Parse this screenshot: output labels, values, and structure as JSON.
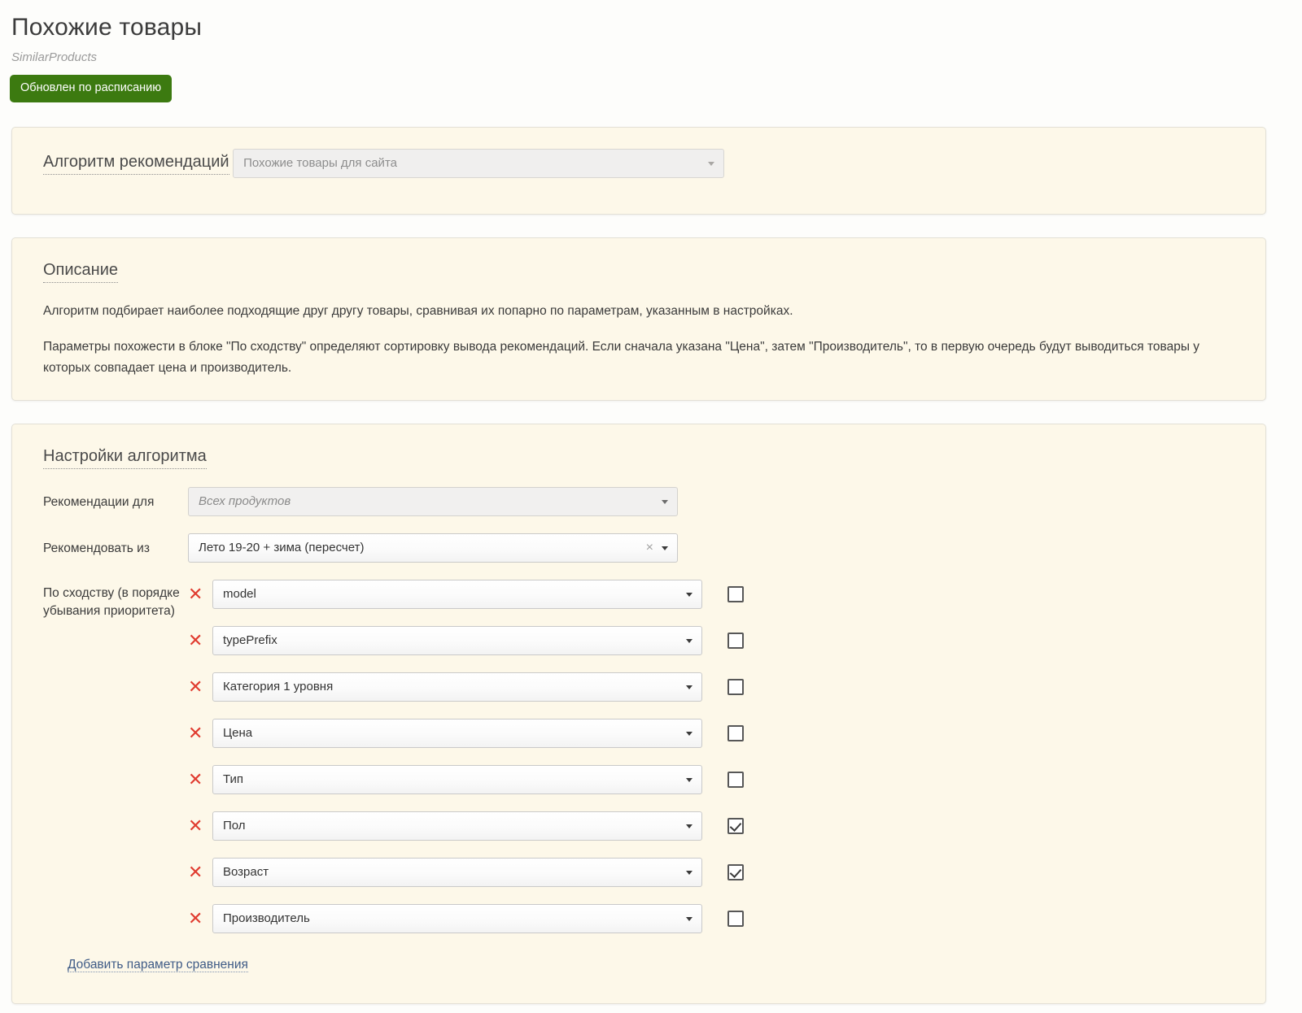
{
  "header": {
    "title": "Похожие товары",
    "subtitle": "SimilarProducts",
    "status_badge": "Обновлен по расписанию",
    "badge_color": "#3c7a10"
  },
  "algorithm_card": {
    "heading": "Алгоритм рекомендаций",
    "select_value": "Похожие товары для сайта",
    "select_disabled": true
  },
  "description_card": {
    "heading": "Описание",
    "paragraphs": [
      "Алгоритм подбирает наиболее подходящие друг другу товары, сравнивая их попарно по параметрам, указанным в настройках.",
      "Параметры похожести в блоке \"По сходству\" определяют сортировку вывода рекомендаций. Если сначала указана \"Цена\", затем \"Производитель\", то в первую очередь будут выводиться товары у которых совпадает цена и производитель."
    ]
  },
  "settings_card": {
    "heading": "Настройки алгоритма",
    "recommend_for": {
      "label": "Рекомендации для",
      "value": "Всех продуктов"
    },
    "recommend_from": {
      "label": "Рекомендовать из",
      "value": "Лето 19-20 + зима (пересчет)",
      "clear_icon": "×"
    },
    "similarity": {
      "label": "По сходству (в порядке убывания приоритета)",
      "remove_icon": "✕",
      "rows": [
        {
          "value": "model",
          "checked": false
        },
        {
          "value": "typePrefix",
          "checked": false
        },
        {
          "value": "Категория 1 уровня",
          "checked": false
        },
        {
          "value": "Цена",
          "checked": false
        },
        {
          "value": "Тип",
          "checked": false
        },
        {
          "value": "Пол",
          "checked": true
        },
        {
          "value": "Возраст",
          "checked": true
        },
        {
          "value": "Производитель",
          "checked": false
        }
      ]
    },
    "add_link": "Добавить параметр сравнения"
  }
}
